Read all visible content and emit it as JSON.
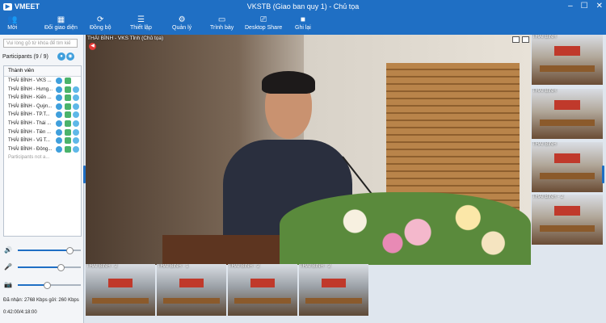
{
  "window": {
    "app_name": "VMEET",
    "title": "VKSTB (Giao ban quy 1) - Chủ tọa"
  },
  "toolbar": [
    {
      "label": "Mời",
      "icon": "invite-icon"
    },
    {
      "label": "Đổi giao diện",
      "icon": "layout-icon"
    },
    {
      "label": "Đồng bộ",
      "icon": "sync-icon"
    },
    {
      "label": "Thiết lập",
      "icon": "settings-icon"
    },
    {
      "label": "Quản lý",
      "icon": "manage-icon"
    },
    {
      "label": "Trình bày",
      "icon": "present-icon"
    },
    {
      "label": "Desktop Share",
      "icon": "desktop-share-icon"
    },
    {
      "label": "Ghi lại",
      "icon": "record-icon"
    }
  ],
  "sidebar": {
    "search_placeholder": "Vui lòng gõ từ khóa để tìm kiế",
    "participants_title": "Participants (9 / 9)",
    "column_header": "Thành viên",
    "participants": [
      "THÁI BÌNH - VKS ...",
      "THÁI BÌNH - Hưng...",
      "THÁI BÌNH - Kiến ...",
      "THÁI BÌNH - Quỳn...",
      "THÁI BÌNH - TP.T...",
      "THÁI BÌNH - Thái ...",
      "THÁI BÌNH - Tiền ...",
      "THÁI BÌNH - Vũ T...",
      "THÁI BÌNH - Đông..."
    ],
    "not_available": "Participants not a...",
    "volume_speaker": 0.82,
    "volume_mic": 0.68,
    "volume_camera": 0.46,
    "bitrate": "Đã nhận: 2768 Kbps gửi: 260 Kbps",
    "timer": "0:42:00/4:18:00"
  },
  "main_video": {
    "label": "THÁI BÌNH - VKS Tỉnh (Chủ tọa)"
  },
  "right_tiles": [
    "THÁI BÌNH",
    "THÁI BÌNH",
    "THÁI BÌNH",
    "THÁI BÌNH - 2"
  ],
  "bottom_tiles": [
    "THÁI BÌNH - 2",
    "THÁI BÌNH - 1",
    "THÁI BÌNH - 2",
    "THÁI BÌNH - 2"
  ]
}
